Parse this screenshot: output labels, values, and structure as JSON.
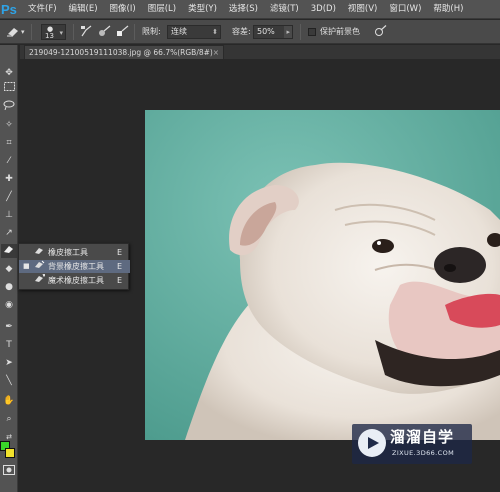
{
  "app": {
    "logo": "Ps"
  },
  "menubar": {
    "items": [
      "文件(F)",
      "编辑(E)",
      "图像(I)",
      "图层(L)",
      "类型(Y)",
      "选择(S)",
      "滤镜(T)",
      "3D(D)",
      "视图(V)",
      "窗口(W)",
      "帮助(H)"
    ]
  },
  "options": {
    "brush_size": "13",
    "limit_label": "限制:",
    "limit_value": "连续",
    "tolerance_label": "容差:",
    "tolerance_value": "50%",
    "protect_fg_label": "保护前景色",
    "protect_fg_checked": false
  },
  "document": {
    "tab_title": "219049-12100519111038.jpg @ 66.7%(RGB/8#)",
    "close_label": "×"
  },
  "toolbox": {
    "foreground_color": "#39d629",
    "background_color": "#f1e12c"
  },
  "flyout": {
    "items": [
      {
        "label": "橡皮擦工具",
        "shortcut": "E",
        "selected": false
      },
      {
        "label": "背景橡皮擦工具",
        "shortcut": "E",
        "selected": true
      },
      {
        "label": "魔术橡皮擦工具",
        "shortcut": "E",
        "selected": false
      }
    ]
  },
  "watermark": {
    "title": "溜溜自学",
    "subtitle": "ZIXUE.3D66.COM"
  }
}
